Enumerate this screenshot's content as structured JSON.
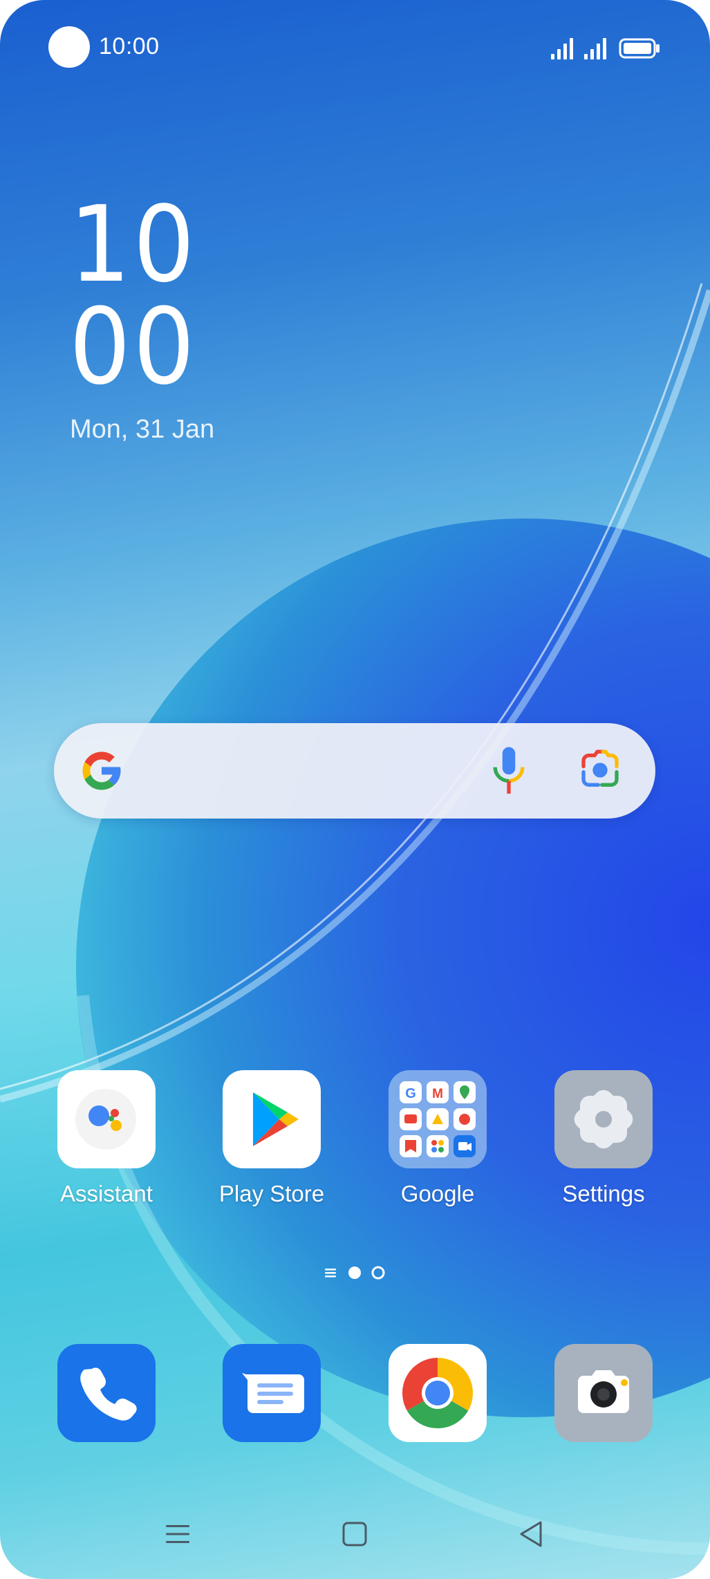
{
  "status_bar": {
    "time": "10:00"
  },
  "clock": {
    "hours": "10",
    "minutes": "00",
    "date": "Mon, 31 Jan"
  },
  "search": {
    "google_logo": "google-g-icon",
    "mic": "mic-icon",
    "lens": "google-lens-icon"
  },
  "apps": [
    {
      "label": "Assistant",
      "icon": "assistant-icon"
    },
    {
      "label": "Play Store",
      "icon": "play-store-icon"
    },
    {
      "label": "Google",
      "icon": "google-folder-icon"
    },
    {
      "label": "Settings",
      "icon": "settings-gear-icon"
    }
  ],
  "page_indicator": {
    "pages": 2,
    "current": 1
  },
  "dock": [
    {
      "icon": "phone-icon"
    },
    {
      "icon": "messages-icon"
    },
    {
      "icon": "chrome-icon"
    },
    {
      "icon": "camera-icon"
    }
  ],
  "nav": {
    "icons": [
      "menu-icon",
      "home-icon",
      "back-icon"
    ]
  },
  "colors": {
    "accent_blue": "#1a73e8",
    "google_blue": "#4285f4",
    "google_red": "#ea4335",
    "google_yellow": "#fbbc05",
    "google_green": "#34a853"
  }
}
